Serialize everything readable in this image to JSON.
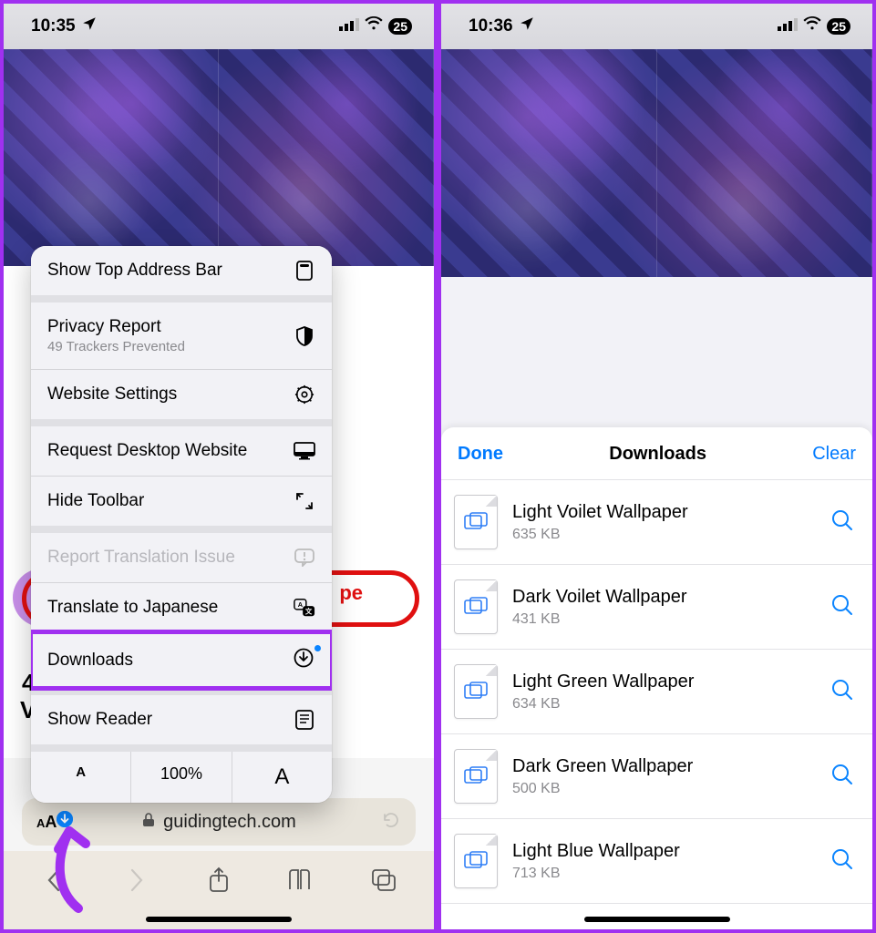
{
  "left": {
    "status": {
      "time": "10:35",
      "battery": "25"
    },
    "menu": {
      "show_top": "Show Top Address Bar",
      "privacy": {
        "title": "Privacy Report",
        "sub": "49 Trackers Prevented"
      },
      "website_settings": "Website Settings",
      "request_desktop": "Request Desktop Website",
      "hide_toolbar": "Hide Toolbar",
      "report_translation": "Report Translation Issue",
      "translate": "Translate to Japanese",
      "downloads": "Downloads",
      "show_reader": "Show Reader",
      "zoom": {
        "small": "A",
        "value": "100%",
        "large": "A"
      }
    },
    "red_text": "pe",
    "bg_4": "4",
    "bg_v": "V",
    "url": {
      "host": "guidingtech.com"
    }
  },
  "right": {
    "status": {
      "time": "10:36",
      "battery": "25"
    },
    "sheet": {
      "done": "Done",
      "title": "Downloads",
      "clear": "Clear",
      "items": [
        {
          "name": "Light Voilet Wallpaper",
          "size": "635 KB"
        },
        {
          "name": "Dark Voilet Wallpaper",
          "size": "431 KB"
        },
        {
          "name": "Light Green Wallpaper",
          "size": "634 KB"
        },
        {
          "name": "Dark Green Wallpaper",
          "size": "500 KB"
        },
        {
          "name": "Light Blue Wallpaper",
          "size": "713 KB"
        }
      ]
    }
  }
}
